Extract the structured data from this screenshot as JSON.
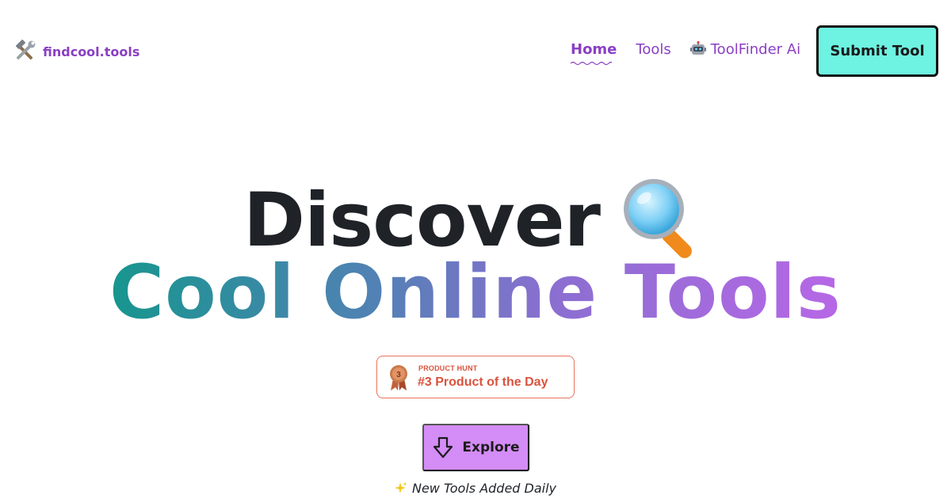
{
  "header": {
    "brand_icon": "tools-icon",
    "brand_name": "findcool.tools",
    "nav": {
      "home": "Home",
      "tools": "Tools",
      "toolfinder_icon": "robot-icon",
      "toolfinder": "ToolFinder Ai"
    },
    "submit_label": "Submit Tool"
  },
  "hero": {
    "line1": "Discover",
    "line1_icon": "magnifying-glass-icon",
    "line2": "Cool Online Tools"
  },
  "badge": {
    "icon": "medal-icon",
    "medal_number": "3",
    "kicker": "PRODUCT HUNT",
    "title": "#3 Product of the Day"
  },
  "explore": {
    "icon": "arrow-down-icon",
    "label": "Explore"
  },
  "tagline": {
    "icon": "sparkles-icon",
    "text": "New Tools Added Daily"
  },
  "colors": {
    "brand_purple": "#8a3fc4",
    "submit_bg": "#6ef2e1",
    "explore_bg": "#d48cf7",
    "badge_accent": "#d9533d",
    "heading_dark": "#1f2328",
    "gradient_start": "#17968e",
    "gradient_end": "#b767e6"
  }
}
